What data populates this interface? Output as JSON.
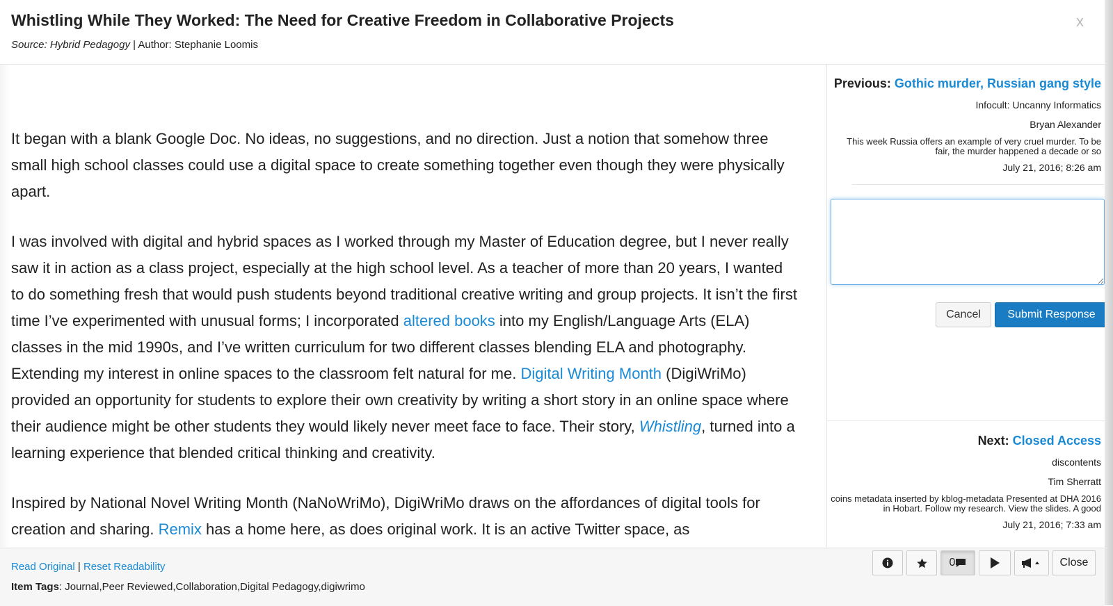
{
  "header": {
    "title": "Whistling While They Worked: The Need for Creative Freedom in Collaborative Projects",
    "source_label": "Source:",
    "source_name": "Hybrid Pedagogy",
    "author_text": " | Author: Stephanie Loomis",
    "close_glyph": "x"
  },
  "article": {
    "p1": "It began with a blank Google Doc. No ideas, no suggestions, and no direction. Just a notion that somehow three small high school classes could use a digital space to create something together even though they were physically apart.",
    "p2_a": "I was involved with digital and hybrid spaces as I worked through my Master of Education degree, but I never really saw it in action as a class project, especially at the high school level. As a teacher of more than 20 years, I wanted to do something fresh that would push students beyond traditional creative writing and group projects. It isn’t the first time I’ve experimented with unusual forms; I incorporated ",
    "p2_link1": "altered books",
    "p2_b": " into my English/Language Arts (ELA) classes in the mid 1990s, and I’ve written curriculum for two different classes blending ELA and photography. Extending my interest in online spaces to the classroom felt natural for me. ",
    "p2_link2": "Digital Writing Month",
    "p2_c": " (DigiWriMo) provided an opportunity for students to explore their own creativity by writing a short story in an online space where their audience might be other students they would likely never meet face to face. Their story, ",
    "p2_link3": "Whistling",
    "p2_d": ", turned into a learning experience that blended critical thinking and creativity.",
    "p3_a": "Inspired by National Novel Writing Month (NaNoWriMo), DigiWriMo draws on the affordances of digital tools for creation and sharing. ",
    "p3_link": "Remix",
    "p3_b": " has a home here, as does original work. It is an active Twitter space, as"
  },
  "sidebar": {
    "previous": {
      "label": "Previous:",
      "title": "Gothic murder, Russian gang style",
      "source": "Infocult: Uncanny Informatics",
      "author": "Bryan Alexander",
      "excerpt": "This week Russia offers an example of very cruel murder. To be fair, the murder happened a decade or so",
      "date": "July 21, 2016; 8:26 am"
    },
    "response": {
      "value": "",
      "cancel_label": "Cancel",
      "submit_label": "Submit Response"
    },
    "next": {
      "label": "Next:",
      "title": "Closed Access",
      "source": "discontents",
      "author": "Tim Sherratt",
      "excerpt": "coins metadata inserted by kblog-metadata Presented at DHA 2016 in Hobart. Follow my research. View the slides. A good",
      "date": "July 21, 2016; 7:33 am"
    }
  },
  "footer": {
    "read_original": "Read Original",
    "divider": " | ",
    "reset_readability": "Reset Readability",
    "tags_label": "Item Tags",
    "tags_value": ": Journal,Peer Reviewed,Collaboration,Digital Pedagogy,digiwrimo",
    "toolbar": {
      "info_icon": "info-icon",
      "star_icon": "star-icon",
      "comment_count": "0",
      "comment_icon": "comment-icon",
      "play_icon": "play-icon",
      "share_icon": "megaphone-icon",
      "close_label": "Close"
    }
  },
  "colors": {
    "link": "#1a8ad4",
    "primary_button": "#1a7cc3",
    "focus_border": "#66afe9"
  }
}
